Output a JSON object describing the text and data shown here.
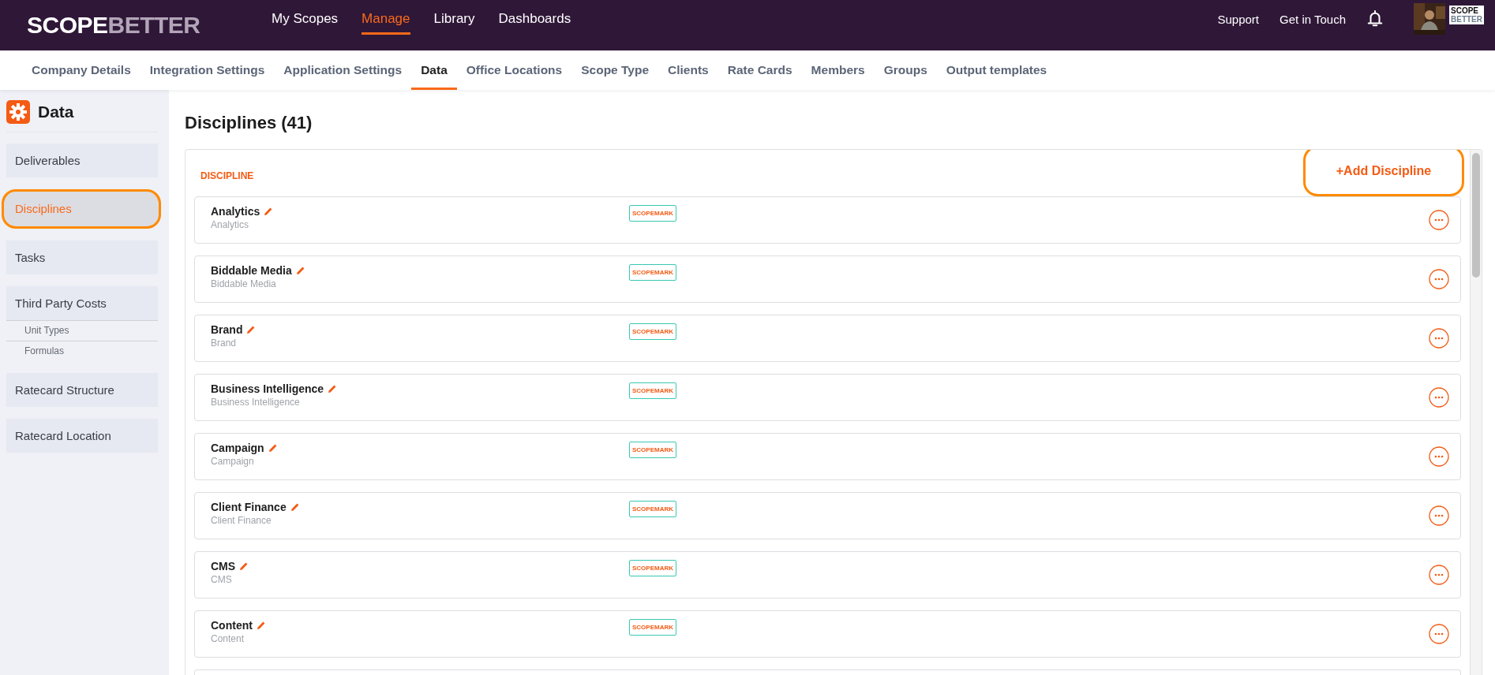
{
  "logo": {
    "part1": "SCOPE",
    "part2": "BETTER"
  },
  "main_nav": [
    {
      "label": "My Scopes",
      "selected": false
    },
    {
      "label": "Manage",
      "selected": true
    },
    {
      "label": "Library",
      "selected": false
    },
    {
      "label": "Dashboards",
      "selected": false
    }
  ],
  "header_links": [
    "Support",
    "Get in Touch"
  ],
  "org_logo": {
    "line1": "SCOPE",
    "line2": "BETTER"
  },
  "sub_nav": [
    {
      "label": "Company Details",
      "selected": false
    },
    {
      "label": "Integration Settings",
      "selected": false
    },
    {
      "label": "Application Settings",
      "selected": false
    },
    {
      "label": "Data",
      "selected": true
    },
    {
      "label": "Office Locations",
      "selected": false
    },
    {
      "label": "Scope Type",
      "selected": false
    },
    {
      "label": "Clients",
      "selected": false
    },
    {
      "label": "Rate Cards",
      "selected": false
    },
    {
      "label": "Members",
      "selected": false
    },
    {
      "label": "Groups",
      "selected": false
    },
    {
      "label": "Output templates",
      "selected": false
    }
  ],
  "sidebar": {
    "title": "Data",
    "items": [
      {
        "label": "Deliverables",
        "selected": false
      },
      {
        "label": "Disciplines",
        "selected": true
      },
      {
        "label": "Tasks",
        "selected": false
      },
      {
        "label": "Third Party Costs",
        "selected": false,
        "children": [
          {
            "label": "Unit Types"
          },
          {
            "label": "Formulas"
          }
        ]
      },
      {
        "label": "Ratecard Structure",
        "selected": false
      },
      {
        "label": "Ratecard Location",
        "selected": false
      }
    ]
  },
  "page_title": "Disciplines (41)",
  "list": {
    "column_header": "DISCIPLINE",
    "add_button": "+Add Discipline",
    "rows": [
      {
        "name": "Analytics",
        "subtitle": "Analytics",
        "tag": "SCOPEMARK"
      },
      {
        "name": "Biddable Media",
        "subtitle": "Biddable Media",
        "tag": "SCOPEMARK"
      },
      {
        "name": "Brand",
        "subtitle": "Brand",
        "tag": "SCOPEMARK"
      },
      {
        "name": "Business Intelligence",
        "subtitle": "Business Intelligence",
        "tag": "SCOPEMARK"
      },
      {
        "name": "Campaign",
        "subtitle": "Campaign",
        "tag": "SCOPEMARK"
      },
      {
        "name": "Client Finance",
        "subtitle": "Client Finance",
        "tag": "SCOPEMARK"
      },
      {
        "name": "CMS",
        "subtitle": "CMS",
        "tag": "SCOPEMARK"
      },
      {
        "name": "Content",
        "subtitle": "Content",
        "tag": "SCOPEMARK"
      }
    ]
  }
}
